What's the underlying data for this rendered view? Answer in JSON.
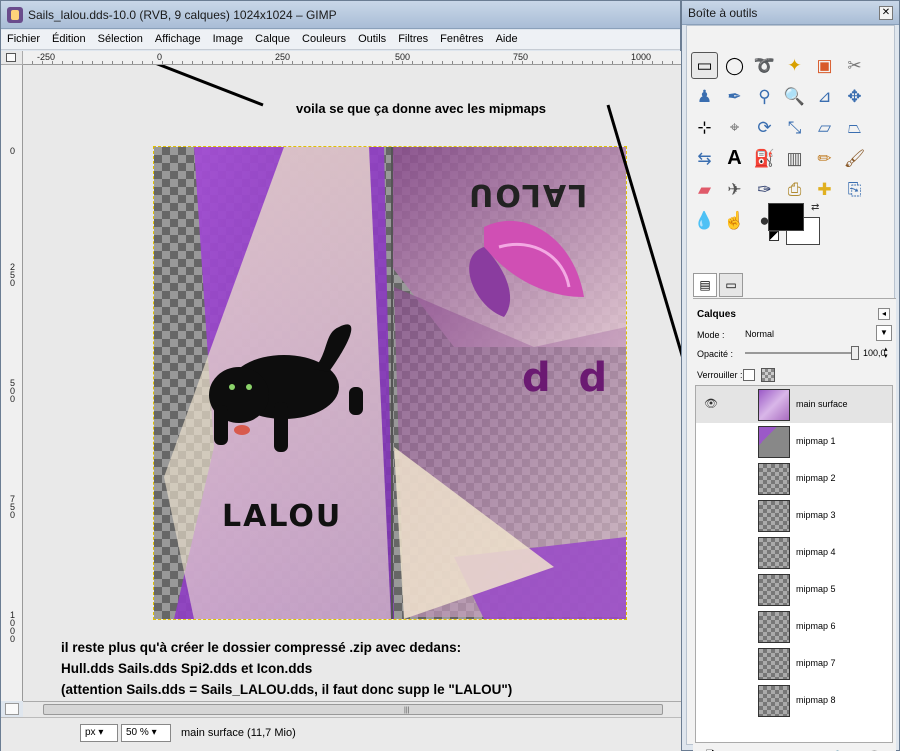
{
  "window": {
    "title": "Sails_lalou.dds-10.0 (RVB, 9 calques) 1024x1024 – GIMP"
  },
  "menubar": [
    "Fichier",
    "Édition",
    "Sélection",
    "Affichage",
    "Image",
    "Calque",
    "Couleurs",
    "Outils",
    "Filtres",
    "Fenêtres",
    "Aide"
  ],
  "rulers": {
    "h_labels": [
      "-250",
      "0",
      "250",
      "500",
      "750",
      "1000"
    ],
    "v_labels": [
      "0",
      "250",
      "500",
      "750",
      "1000"
    ]
  },
  "image_content": {
    "text_left": "LALOU",
    "text_right_mirrored": "LALOU",
    "text_dd": "d  d"
  },
  "annotations": {
    "top_note": "voila se que ça donne avec les mipmaps",
    "bottom_lines": [
      "il reste plus qu'à créer le dossier compressé .zip avec dedans:",
      "Hull.dds   Sails.dds   Spi2.dds   et   Icon.dds",
      "(attention Sails.dds = Sails_LALOU.dds, il faut donc supp le \"LALOU\")"
    ]
  },
  "statusbar": {
    "unit": "px",
    "zoom": "50 %",
    "info": "main surface  (11,7 Mio)"
  },
  "toolbox": {
    "title": "Boîte à outils",
    "fg_color": "#000000",
    "bg_color": "#ffffff"
  },
  "layers": {
    "title": "Calques",
    "mode_label": "Mode :",
    "mode_value": "Normal",
    "opacity_label": "Opacité :",
    "opacity_value": "100,0",
    "lock_label": "Verrouiller :",
    "items": [
      {
        "name": "main surface",
        "visible": true,
        "selected": true
      },
      {
        "name": "mipmap 1"
      },
      {
        "name": "mipmap 2"
      },
      {
        "name": "mipmap 3"
      },
      {
        "name": "mipmap 4"
      },
      {
        "name": "mipmap 5"
      },
      {
        "name": "mipmap 6"
      },
      {
        "name": "mipmap 7"
      },
      {
        "name": "mipmap 8"
      }
    ]
  },
  "colors": {
    "accent_purple": "#9b4fc9",
    "title_bar": "#b9cbe0"
  }
}
